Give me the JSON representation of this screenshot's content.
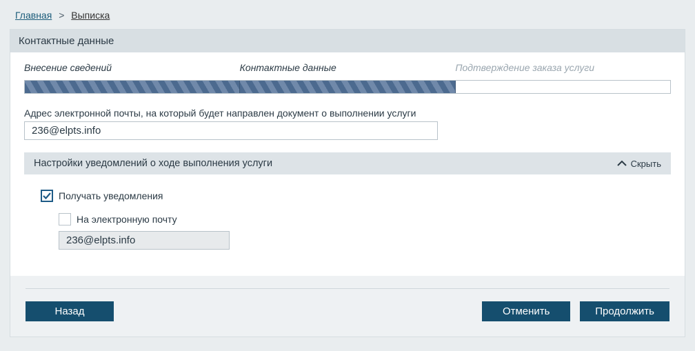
{
  "breadcrumb": {
    "home": "Главная",
    "current": "Выписка"
  },
  "panel_title": "Контактные данные",
  "steps": {
    "s1": "Внесение сведений",
    "s2": "Контактные данные",
    "s3": "Подтверждение заказа услуги"
  },
  "email_field": {
    "label": "Адрес электронной почты, на который будет направлен документ о выполнении услуги",
    "value": "236@elpts.info"
  },
  "notifications_panel": {
    "title": "Настройки уведомлений о ходе выполнения услуги",
    "toggle_label": "Скрыть",
    "receive_label": "Получать уведомления",
    "via_email_label": "На электронную почту",
    "email_value": "236@elpts.info"
  },
  "buttons": {
    "back": "Назад",
    "cancel": "Отменить",
    "continue": "Продолжить"
  }
}
